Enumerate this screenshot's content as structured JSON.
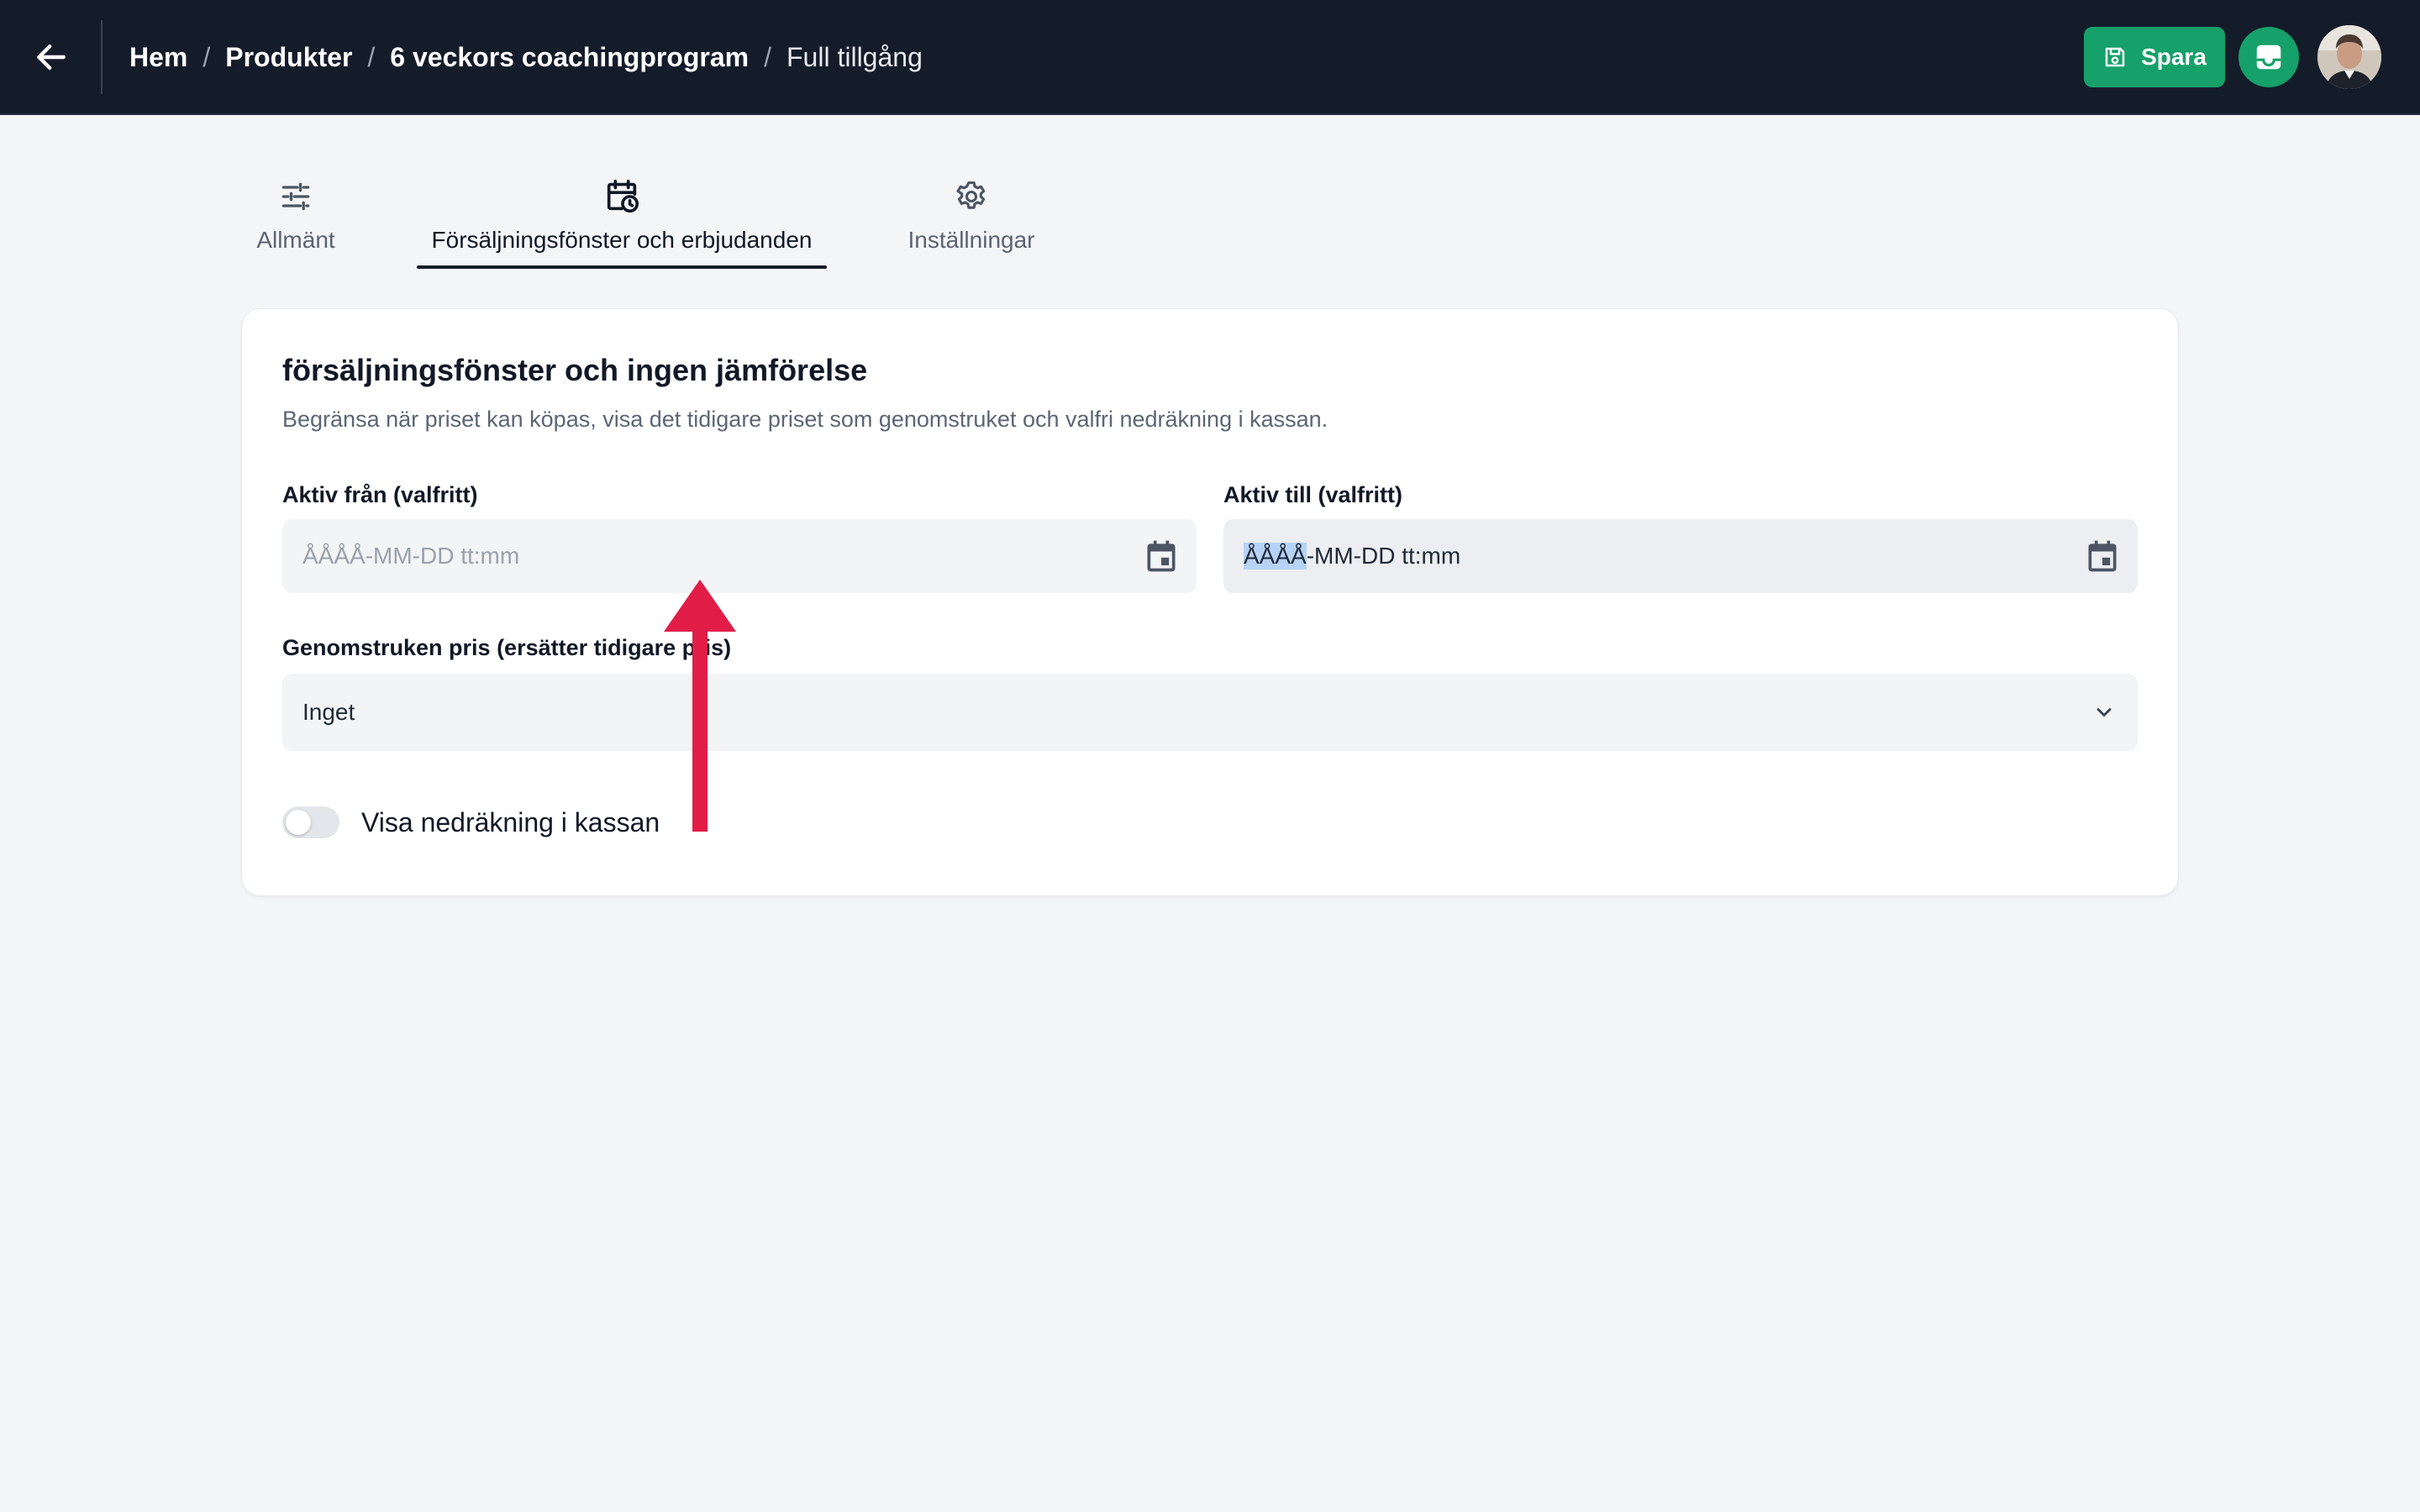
{
  "header": {
    "breadcrumb": [
      "Hem",
      "Produkter",
      "6 veckors coachingprogram"
    ],
    "current": "Full tillgång",
    "separator": "/",
    "save_label": "Spara"
  },
  "tabs": [
    {
      "label": "Allmänt",
      "icon": "sliders-icon"
    },
    {
      "label": "Försäljningsfönster och erbjudanden",
      "icon": "calendar-clock-icon",
      "active": true
    },
    {
      "label": "Inställningar",
      "icon": "gear-icon"
    }
  ],
  "card": {
    "title": "försäljningsfönster och ingen jämförelse",
    "description": "Begränsa när priset kan köpas, visa det tidigare priset som genomstruket och valfri nedräkning i kassan.",
    "active_from": {
      "label": "Aktiv från (valfritt)",
      "placeholder": "ÅÅÅÅ-MM-DD tt:mm"
    },
    "active_to": {
      "label": "Aktiv till (valfritt)",
      "value_selected": "ÅÅÅÅ",
      "value_rest": "-MM-DD tt:mm"
    },
    "strikethrough": {
      "label": "Genomstruken pris (ersätter tidigare pris)",
      "value": "Inget"
    },
    "countdown": {
      "label": "Visa nedräkning i kassan",
      "enabled": false
    }
  },
  "colors": {
    "topbar": "#141c2a",
    "accent": "#16a06a",
    "annotation_arrow": "#e11d48"
  }
}
